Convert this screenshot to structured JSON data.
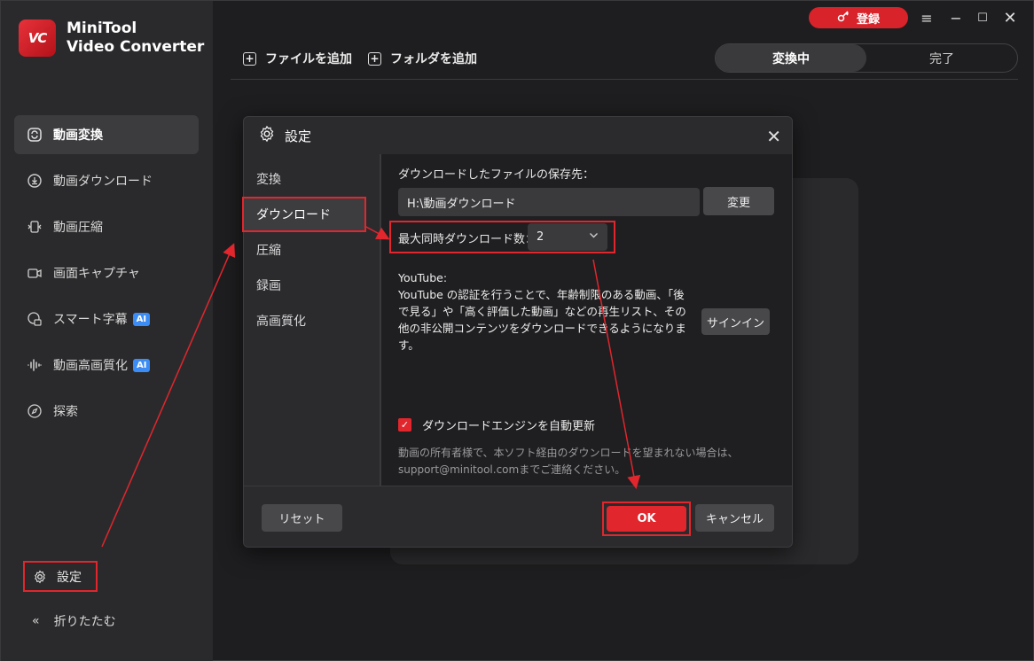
{
  "app": {
    "logo_mark": "VC",
    "name_line1": "MiniTool",
    "name_line2": "Video Converter"
  },
  "sidebar": {
    "items": [
      {
        "label": "動画変換",
        "icon": "convert-icon",
        "active": true,
        "ai": false
      },
      {
        "label": "動画ダウンロード",
        "icon": "download-icon",
        "active": false,
        "ai": false
      },
      {
        "label": "動画圧縮",
        "icon": "compress-icon",
        "active": false,
        "ai": false
      },
      {
        "label": "画面キャプチャ",
        "icon": "camera-icon",
        "active": false,
        "ai": false
      },
      {
        "label": "スマート字幕",
        "icon": "subtitle-icon",
        "active": false,
        "ai": true
      },
      {
        "label": "動画高画質化",
        "icon": "waveform-icon",
        "active": false,
        "ai": true
      },
      {
        "label": "探索",
        "icon": "compass-icon",
        "active": false,
        "ai": false
      }
    ],
    "ai_badge": "AI",
    "settings_label": "設定",
    "collapse_label": "折りたたむ"
  },
  "titlebar": {
    "login_label": "登録"
  },
  "toolbar": {
    "add_file": "ファイルを追加",
    "add_folder": "フォルダを追加",
    "tab_converting": "変換中",
    "tab_done": "完了"
  },
  "dialog": {
    "title": "設定",
    "nav": [
      "変換",
      "ダウンロード",
      "圧縮",
      "録画",
      "高画質化"
    ],
    "save_location_label": "ダウンロードしたファイルの保存先：",
    "save_path": "H:\\動画ダウンロード",
    "change_button": "変更",
    "max_downloads_label": "最大同時ダウンロード数：",
    "max_downloads_value": "2",
    "youtube_title": "YouTube:",
    "youtube_desc": "YouTube の認証を行うことで、年齢制限のある動画、「後で見る」や「高く評価した動画」などの再生リスト、その他の非公開コンテンツをダウンロードできるようになります。",
    "signin_button": "サインイン",
    "auto_update_label": "ダウンロードエンジンを自動更新",
    "auto_update_checked": true,
    "note_line1": "動画の所有者様で、本ソフト経由のダウンロードを望まれない場合は、",
    "note_line2": "support@minitool.comまでご連絡ください。",
    "reset_button": "リセット",
    "ok_button": "OK",
    "cancel_button": "キャンセル"
  },
  "colors": {
    "accent": "#e1262d",
    "sidebar_bg": "#2a2a2c",
    "app_bg": "#1e1e20",
    "ai_badge": "#3b8cf5"
  }
}
